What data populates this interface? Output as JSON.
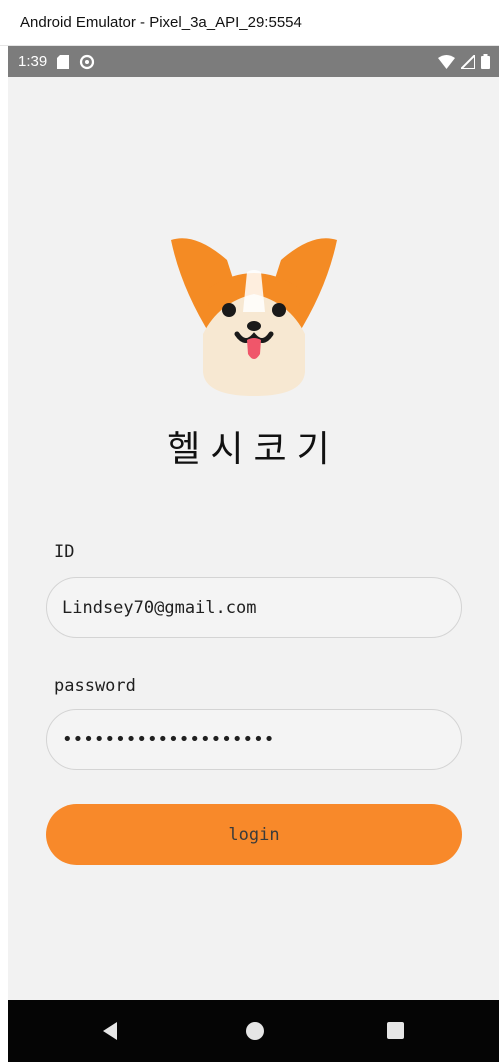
{
  "window": {
    "title": "Android Emulator - Pixel_3a_API_29:5554"
  },
  "status_bar": {
    "time": "1:39",
    "icons": [
      "sd-card-icon",
      "sync-icon",
      "wifi-icon",
      "signal-icon",
      "battery-icon"
    ]
  },
  "app": {
    "title": "헬시코기",
    "logo": "corgi-logo-icon"
  },
  "login_form": {
    "id_label": "ID",
    "id_value": "Lindsey70@gmail.com",
    "password_label": "password",
    "password_value": "••••••••••••••••••••",
    "login_label": "login"
  },
  "colors": {
    "accent": "#f8892a",
    "background": "#f2f2f2",
    "status_bar": "#7c7c7c",
    "nav_bar": "#050505"
  },
  "nav_bar": {
    "icons": [
      "back-icon",
      "home-icon",
      "recent-apps-icon"
    ]
  }
}
